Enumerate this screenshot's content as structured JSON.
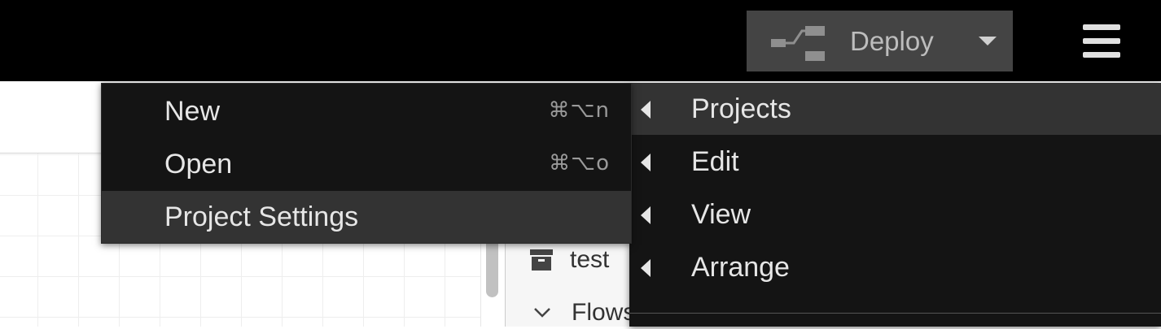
{
  "header": {
    "deploy_label": "Deploy"
  },
  "sidebar": {
    "item_label": "test",
    "flows_label": "Flows"
  },
  "file_submenu": {
    "items": [
      {
        "label": "New",
        "shortcut": "⌘⌥n"
      },
      {
        "label": "Open",
        "shortcut": "⌘⌥o"
      },
      {
        "label": "Project Settings",
        "shortcut": ""
      }
    ]
  },
  "main_menu": {
    "items": [
      {
        "label": "Projects"
      },
      {
        "label": "Edit"
      },
      {
        "label": "View"
      },
      {
        "label": "Arrange"
      }
    ]
  },
  "colors": {
    "header_bg": "#000000",
    "menu_bg": "#141414",
    "menu_active_bg": "#333333",
    "deploy_bg": "#444444"
  }
}
